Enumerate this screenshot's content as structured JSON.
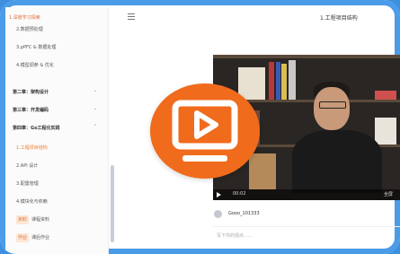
{
  "sidebar": {
    "header": "1.深度学习探索",
    "items": [
      {
        "label": "2.数据预处理",
        "type": "sub"
      },
      {
        "label": "3.pPFC & 数据处理",
        "type": "sub"
      },
      {
        "label": "4.模型调参 & 优化",
        "type": "sub"
      },
      {
        "label": "第二章：架构设计",
        "type": "chapter"
      },
      {
        "label": "第三章：开发编码",
        "type": "chapter"
      },
      {
        "label": "第四章：Go工程化实践",
        "type": "chapter"
      },
      {
        "label": "1.工程项目结构",
        "type": "sub-active"
      },
      {
        "label": "2.API 设计",
        "type": "sub"
      },
      {
        "label": "3.配置管理",
        "type": "sub"
      },
      {
        "label": "4.模块化与依赖",
        "type": "sub"
      },
      {
        "label": "课程资料",
        "type": "badge",
        "badge": "资料"
      },
      {
        "label": "课后作业",
        "type": "badge",
        "badge": "作业"
      }
    ]
  },
  "header": {
    "title": "1.工程项目结构"
  },
  "player": {
    "current_time": "00:02",
    "fullscreen": "全屏"
  },
  "comment": {
    "username": "Gooo_101333",
    "placeholder": "写下你的观点……"
  },
  "colors": {
    "accent": "#f06b1c",
    "frame": "#3d8fe0"
  }
}
